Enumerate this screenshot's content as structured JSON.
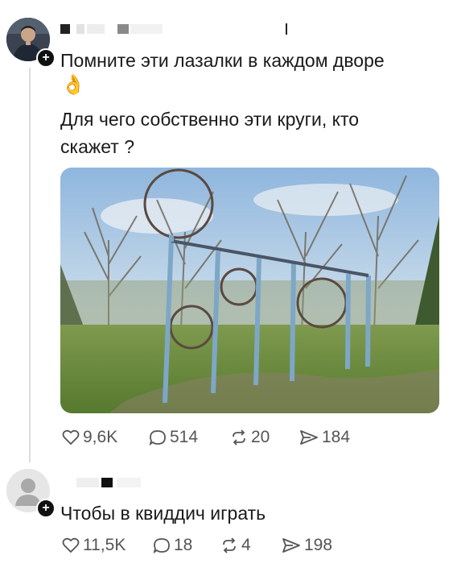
{
  "post": {
    "line1": "Помните эти лазалки в каждом дворе",
    "emoji": "👌",
    "line2": "Для чего собственно эти круги, кто",
    "line3": "скажет ?",
    "stats": {
      "likes": "9,6K",
      "comments": "514",
      "reposts": "20",
      "shares": "184"
    }
  },
  "reply": {
    "text": "Чтобы в квиддич играть",
    "stats": {
      "likes": "11,5K",
      "comments": "18",
      "reposts": "4",
      "shares": "198"
    }
  },
  "icons": {
    "like": "heart-icon",
    "comment": "comment-bubble-icon",
    "repost": "repost-icon",
    "share": "send-icon",
    "follow": "plus-icon"
  },
  "colors": {
    "text": "#1a1a1a",
    "muted": "#555555",
    "thread": "#dcdcdc"
  }
}
